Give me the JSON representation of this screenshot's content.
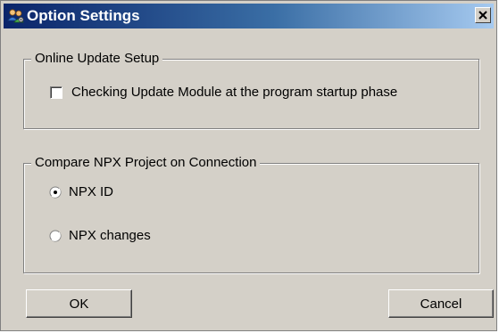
{
  "window": {
    "title": "Option Settings",
    "close_glyph": "×"
  },
  "online_update": {
    "legend": "Online Update Setup",
    "checkbox_label": "Checking Update Module at the program startup phase",
    "checked": false
  },
  "compare": {
    "legend": "Compare NPX Project on Connection",
    "options": [
      {
        "label": "NPX ID",
        "selected": true
      },
      {
        "label": "NPX changes",
        "selected": false
      }
    ]
  },
  "buttons": {
    "ok": "OK",
    "cancel": "Cancel"
  },
  "colors": {
    "face": "#d4d0c8",
    "title_start": "#0a246a",
    "title_end": "#a6caf0"
  },
  "icons": {
    "title": "settings-people-icon",
    "close": "close-icon"
  }
}
